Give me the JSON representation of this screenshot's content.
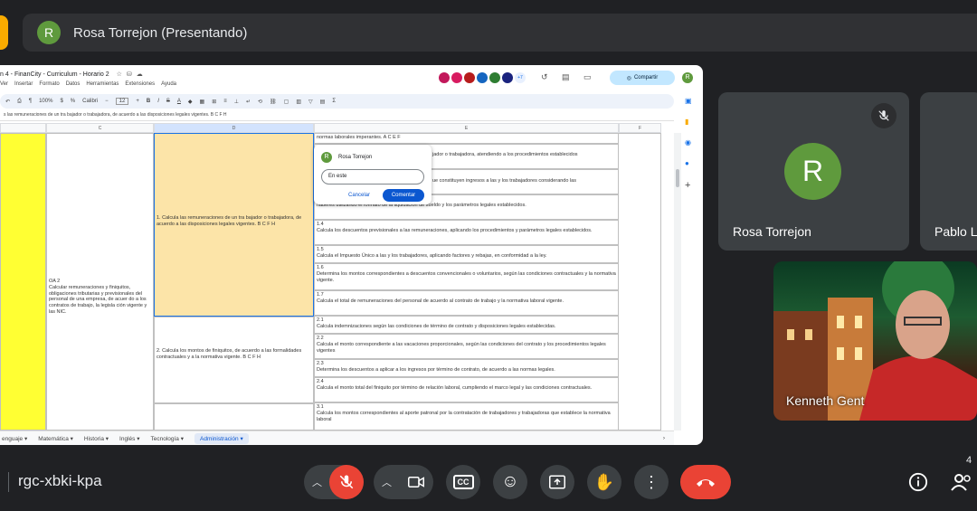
{
  "presenter": {
    "avatar_letter": "R",
    "banner": "Rosa Torrejon (Presentando)"
  },
  "sheet": {
    "title": "n 4 - FinanCity - Curriculum - Horario 2",
    "menu": [
      "Ver",
      "Insertar",
      "Formato",
      "Datos",
      "Herramientas",
      "Extensiones",
      "Ayuda"
    ],
    "toolbar": {
      "zoom": "100%",
      "font": "Calibri",
      "font_size": "12"
    },
    "formula": "s las remuneraciones de un tra bajador o trabajadora, de acuerdo a las disposiciones legales vigentes. B C F H",
    "collab_extra": "+7",
    "share_label": "Compartir",
    "columns": [
      "C",
      "D",
      "E",
      "F"
    ],
    "oa_cell": "OA 2\nCalcular remuneraciones y finiquitos, obligaciones tributarias y previsionales del personal de una empresa, de acuer do a los contratos de trabajo, la legisla ción vigente y las NIC.",
    "d1": "1. Calcula las remuneraciones de un tra bajador o trabajadora, de acuerdo a las disposiciones legales vigentes. B C F H",
    "d2": "2. Calcula los montos de finiquitos, de acuerdo a las formalidades contractuales y a la normativa vigente. B C F H",
    "e_rows": [
      "normas laborales imperantes. A C E F",
      "jador o trabajadora, atendiendo a los procedimientos establecidos",
      "ue constituyen ingresos a las y los trabajadores considerando las",
      "haberes utilizando el formato de la liquidación de sueldo y los parámetros legales establecidos.",
      "1.4\nCalcula los descuentos previsionales a las remuneraciones, aplicando los procedimientos y parámetros legales establecidos.",
      "1.5\nCalcula el Impuesto Único a las y los trabajadores, aplicando factores y rebajas, en conformidad a la ley.",
      "1.6\nDetermina los montos correspondientes a descuentos convencionales o voluntarios, según las condiciones contractuales y la normativa vigente.",
      "1.7\nCalcula el total de remuneraciones del personal de acuerdo al contrato de trabajo y la normativa laboral vigente.",
      "2.1\nCalcula indemnizaciones según las condiciones de término de contrato y disposiciones legales establecidas.",
      "2.2\nCalcula el monto correspondiente a las vacaciones proporcionales, según las condiciones del contrato y los procedimientos legales vigentes",
      "2.3\nDetermina los descuentos a aplicar a los ingresos por término de contrato, de acuerdo a las normas legales.",
      "2.4\nCalcula el monto total del finiquito por término de relación laboral, cumpliendo el marco legal y las condiciones contractuales.",
      "3.1\nCalcula los montos correspondientes al aporte patronal por la contratación de trabajadores y trabajadoras que establece la normativa laboral"
    ],
    "comment": {
      "author": "Rosa Torrejon",
      "avatar_letter": "R",
      "input_value": "En este",
      "cancel": "Cancelar",
      "submit": "Comentar"
    },
    "tabs": [
      "enguaje",
      "Matemática",
      "Historia",
      "Inglés",
      "Tecnología",
      "Administración"
    ]
  },
  "participants": {
    "rosa": {
      "letter": "R",
      "name": "Rosa Torrejon"
    },
    "pablo": {
      "name": "Pablo L"
    },
    "kenneth": {
      "name": "Kenneth Gent"
    }
  },
  "meeting": {
    "code": "rgc-xbki-kpa",
    "participant_count": "4"
  },
  "colors": {
    "accent_red": "#ea4335",
    "avatar_green": "#5f9a3d",
    "highlight_yellow": "#ffff33",
    "cell_orange": "#fce4a8"
  }
}
